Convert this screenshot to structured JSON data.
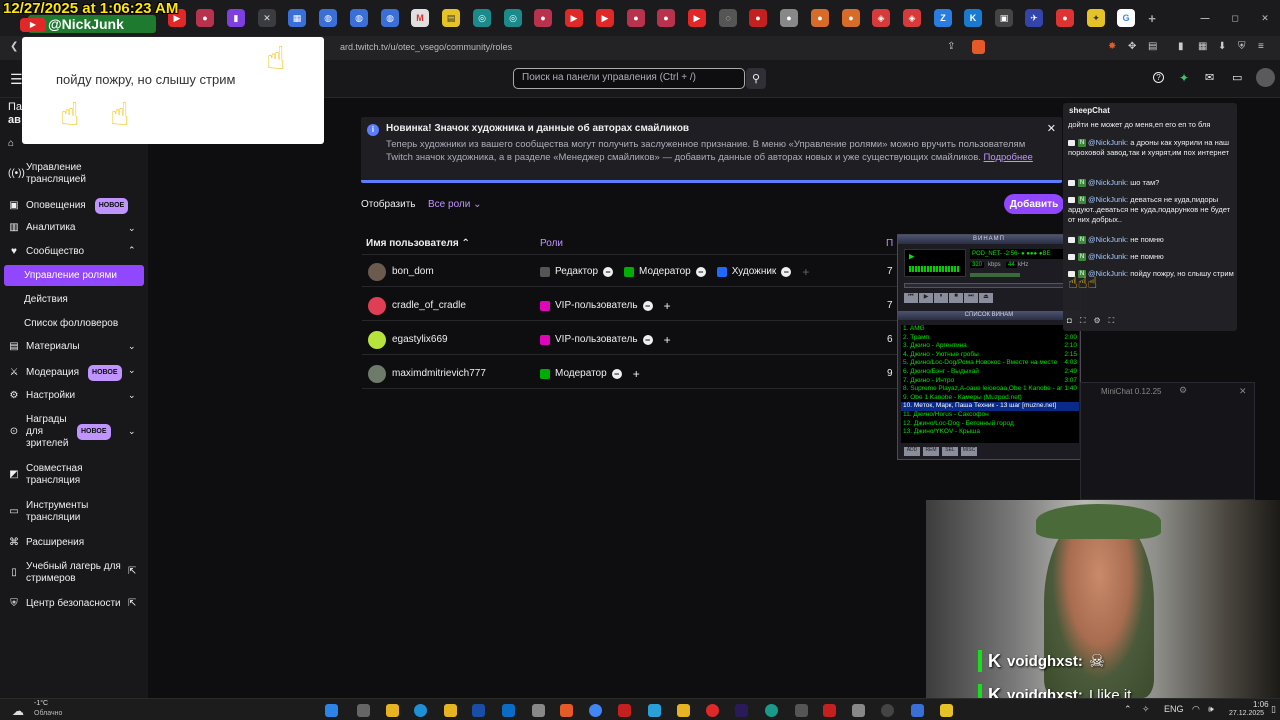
{
  "overlay": {
    "timestamp": "12/27/2025 at 1:06:23 AM",
    "nick": "@NickJunk",
    "nick_badge": "N",
    "popup_text": "пойду пожру, но слышу стрим"
  },
  "browser": {
    "url": "ard.twitch.tv/u/otec_vsego/community/roles"
  },
  "header": {
    "search_placeholder": "Поиск на панели управления (Ctrl + /)"
  },
  "sidebar": {
    "items": [
      {
        "label": "Управление трансляцией",
        "icon": "broadcast-icon"
      },
      {
        "label": "Оповещения",
        "icon": "alert-icon",
        "badge": "НОВОЕ"
      },
      {
        "label": "Аналитика",
        "icon": "analytics-icon"
      },
      {
        "label": "Сообщество",
        "icon": "community-icon"
      },
      {
        "label": "Управление ролями"
      },
      {
        "label": "Действия"
      },
      {
        "label": "Список фолловеров"
      },
      {
        "label": "Материалы",
        "icon": "content-icon"
      },
      {
        "label": "Модерация",
        "icon": "shield-icon",
        "badge": "НОВОЕ"
      },
      {
        "label": "Настройки",
        "icon": "gear-icon"
      },
      {
        "label": "Награды для зрителей",
        "icon": "reward-icon",
        "badge": "НОВОЕ"
      },
      {
        "label": "Совместная трансляция",
        "icon": "collab-icon"
      },
      {
        "label": "Инструменты трансляции",
        "icon": "tools-icon"
      },
      {
        "label": "Расширения",
        "icon": "extensions-icon"
      },
      {
        "label": "Учебный лагерь для стримеров",
        "icon": "bootcamp-icon"
      },
      {
        "label": "Центр безопасности",
        "icon": "safety-icon"
      }
    ]
  },
  "notice": {
    "title": "Новинка! Значок художника и данные об авторах смайликов",
    "body": "Теперь художники из вашего сообщества могут получить заслуженное признание. В меню «Управление ролями» можно вручить пользователям Twitch значок художника, а в разделе «Менеджер смайликов» — добавить данные об авторах новых и уже существующих смайликов.",
    "link": "Подробнее"
  },
  "filter": {
    "label": "Отобразить",
    "value": "Все роли",
    "add_button": "Добавить"
  },
  "table": {
    "col_user": "Имя пользователя",
    "col_roles": "Роли",
    "col_third": "П",
    "rows": [
      {
        "user": "bon_dom",
        "roles": [
          "Редактор",
          "Модератор",
          "Художник"
        ],
        "n": "7",
        "avatar": "#6b5a4e"
      },
      {
        "user": "cradle_of_cradle",
        "roles": [
          "VIP-пользователь"
        ],
        "n": "7",
        "avatar": "#e03e54"
      },
      {
        "user": "egastylix669",
        "roles": [
          "VIP-пользователь"
        ],
        "n": "6",
        "avatar": "#b6e33c"
      },
      {
        "user": "maximdmitrievich777",
        "roles": [
          "Модератор"
        ],
        "n": "9",
        "avatar": "#6e7a6a"
      }
    ]
  },
  "winamp": {
    "title": "ВИНАМП",
    "song_scroll": "POD_NET- -2:56- ● ●●● ●BE",
    "kbps": "320",
    "khz": "44",
    "playlist_title": "СПИСОК ВИНАМ",
    "playlist": [
      {
        "t": "1. AMG",
        "d": ""
      },
      {
        "t": "2. Трамп",
        "d": "2:00"
      },
      {
        "t": "3. Джино - Аргентина",
        "d": "2:10"
      },
      {
        "t": "4. Джино - Уютные гробы",
        "d": "2:15"
      },
      {
        "t": "5. Джино/Loc-Dog/Рома Новокос - Вместе на месте",
        "d": "4:03"
      },
      {
        "t": "6. Джино/Бэнг - Выдыхай",
        "d": "2:49"
      },
      {
        "t": "7. Джино - Интро",
        "d": "3:07"
      },
      {
        "t": "8. Supreme Playaz,A-oaue leioeoaa,Obe 1 Kanobe - ar",
        "d": "1:40"
      },
      {
        "t": "9. Obe 1 Kanobe - Камеры (Muzpod.net)",
        "d": ""
      },
      {
        "t": "10. Meток, Марк, Паша Техник - 13 шаг [muzne.net]",
        "d": ""
      },
      {
        "t": "11. Джино/Horus - Саксофон",
        "d": ""
      },
      {
        "t": "12. Джино/Loc-Dog - Бетонный город",
        "d": ""
      },
      {
        "t": "13. Джино/YKOV - Крыша",
        "d": ""
      }
    ]
  },
  "minichat": {
    "title": "MiniChat 0.12.25"
  },
  "sheepchat": {
    "title": "sheepChat",
    "messages": [
      {
        "nick": "",
        "text": "дойти не может до меня,еп его еп то бля"
      },
      {
        "nick": "@NickJunk:",
        "text": "а дроны как хуярили на наш пороховой завод,так и хуярят,им пох интернет"
      },
      {
        "nick": "@NickJunk:",
        "text": "шо там?"
      },
      {
        "nick": "@NickJunk:",
        "text": "деваться не куда,пидоры ардуют..деваться не куда,подарунков не будет от них добрых.."
      },
      {
        "nick": "@NickJunk:",
        "text": "не помню"
      },
      {
        "nick": "@NickJunk:",
        "text": "не помню"
      },
      {
        "nick": "@NickJunk:",
        "text": "пойду пожру, но слышу стрим"
      }
    ]
  },
  "webcam": {
    "msg1_user": "voidghxst:",
    "msg2_user": "voidghxst:",
    "msg2_text": "I like it"
  },
  "taskbar": {
    "temp": "-1°C",
    "weather": "Облачно",
    "lang": "ENG",
    "time": "1:06",
    "date": "27.12.2025"
  }
}
